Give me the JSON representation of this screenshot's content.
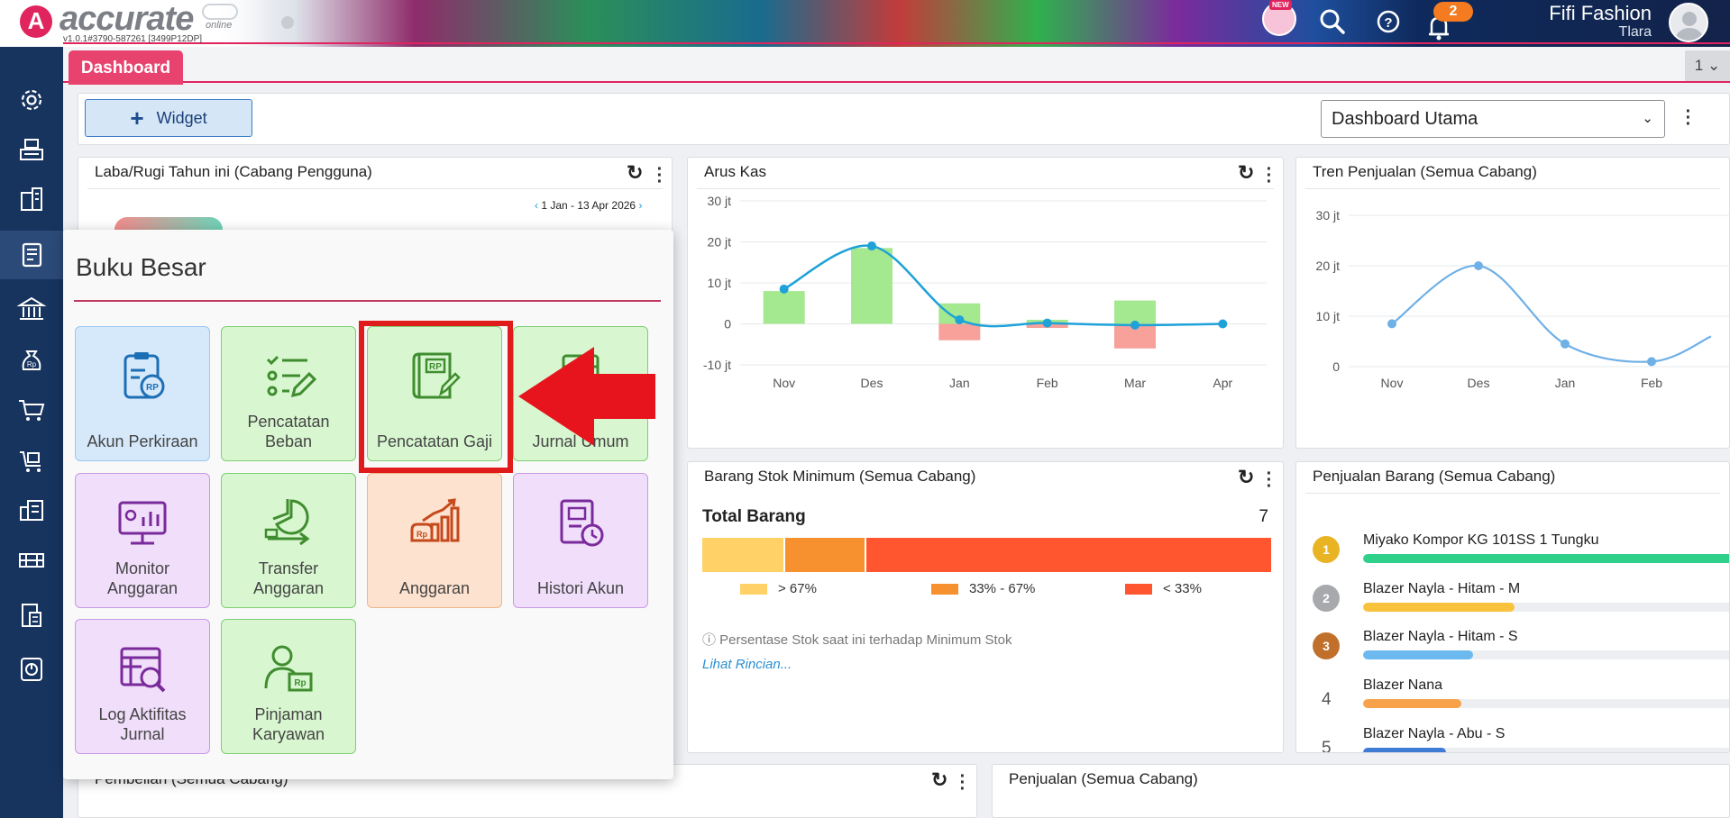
{
  "header": {
    "logo_letter": "A",
    "logo_text": "accurate",
    "logo_sub": "online",
    "version": "v1.0.1#3790-587261 [3499P12DP]",
    "new_badge": "NEW",
    "notification_count": "2",
    "user_name": "Fifi Fashion",
    "user_branch": "Tlara"
  },
  "tabs": {
    "active": "Dashboard",
    "count": "1"
  },
  "toolbar": {
    "widget_label": "Widget",
    "dashboard_select": "Dashboard Utama",
    "dropdown_chevron": "⌄"
  },
  "sidebar": {
    "items": [
      {
        "icon": "settings-icon"
      },
      {
        "icon": "cash-register-icon"
      },
      {
        "icon": "building-icon"
      },
      {
        "icon": "ledger-book-icon",
        "active": true
      },
      {
        "icon": "bank-icon"
      },
      {
        "icon": "money-bag-icon"
      },
      {
        "icon": "shopping-cart-icon"
      },
      {
        "icon": "cart-box-icon"
      },
      {
        "icon": "warehouse-icon"
      },
      {
        "icon": "factory-icon"
      },
      {
        "icon": "tax-document-icon"
      },
      {
        "icon": "report-chart-icon"
      }
    ]
  },
  "panels": {
    "laba_rugi": {
      "title": "Laba/Rugi Tahun ini (Cabang Pengguna)",
      "date_range": "1 Jan - 13 Apr 2026"
    },
    "arus_kas": {
      "title": "Arus Kas"
    },
    "tren_penjualan": {
      "title": "Tren Penjualan (Semua Cabang)"
    },
    "stok_minimum": {
      "title": "Barang Stok Minimum (Semua Cabang)",
      "total_label": "Total Barang",
      "total_value": "7",
      "legend": [
        {
          "label": "> 67%",
          "color": "#ffd166"
        },
        {
          "label": "33% - 67%",
          "color": "#f7912f"
        },
        {
          "label": "< 33%",
          "color": "#ff5630"
        }
      ],
      "note": "ⓘ Persentase Stok saat ini terhadap Minimum Stok",
      "link": "Lihat Rincian..."
    },
    "penjualan_barang": {
      "title": "Penjualan Barang (Semua Cabang)",
      "items": [
        {
          "rank": "1",
          "name": "Miyako Kompor KG 101SS 1 Tungku",
          "share": 1.0,
          "color": "#2fd18a",
          "badge": "#e9b424"
        },
        {
          "rank": "2",
          "name": "Blazer Nayla - Hitam - M",
          "share": 0.4,
          "color": "#f9c23c",
          "badge": "#a7a9ad"
        },
        {
          "rank": "3",
          "name": "Blazer Nayla - Hitam - S",
          "share": 0.29,
          "color": "#6cb9ef",
          "badge": "#c0702b"
        },
        {
          "rank": "4",
          "name": "Blazer Nana",
          "share": 0.26,
          "color": "#f7a24a",
          "badge": ""
        },
        {
          "rank": "5",
          "name": "Blazer Nayla - Abu - S",
          "share": 0.22,
          "color": "#3f7cd6",
          "badge": ""
        }
      ]
    },
    "pembelian": {
      "title": "Pembelian (Semua Cabang)"
    },
    "penjualan": {
      "title": "Penjualan (Semua Cabang)"
    }
  },
  "popup": {
    "title": "Buku Besar",
    "tiles": [
      {
        "label": "Akun Perkiraan",
        "icon": "account-clipboard-icon",
        "color": "blue"
      },
      {
        "label": "Pencatatan Beban",
        "icon": "expense-checklist-icon",
        "color": "green"
      },
      {
        "label": "Pencatatan Gaji",
        "icon": "payroll-book-icon",
        "color": "green"
      },
      {
        "label": "Jurnal Umum",
        "icon": "journal-icon",
        "color": "green"
      },
      {
        "label": "Monitor Anggaran",
        "icon": "budget-monitor-icon",
        "color": "purple"
      },
      {
        "label": "Transfer Anggaran",
        "icon": "budget-transfer-icon",
        "color": "green"
      },
      {
        "label": "Anggaran",
        "icon": "budget-chart-icon",
        "color": "orange"
      },
      {
        "label": "Histori Akun",
        "icon": "account-history-icon",
        "color": "purple"
      },
      {
        "label": "Log Aktifitas Jurnal",
        "icon": "journal-log-icon",
        "color": "purple"
      },
      {
        "label": "Pinjaman Karyawan",
        "icon": "employee-loan-icon",
        "color": "green"
      }
    ]
  },
  "chart_data": [
    {
      "type": "bar",
      "title": "Arus Kas",
      "categories": [
        "Nov",
        "Des",
        "Jan",
        "Feb",
        "Mar",
        "Apr"
      ],
      "series": [
        {
          "values": [
            8,
            18.5,
            5,
            1,
            5.7,
            0
          ]
        },
        {
          "values": [
            0,
            0,
            -4,
            -1,
            -6,
            0
          ]
        },
        {
          "values": [
            8.5,
            19,
            1,
            0.2,
            -0.3,
            0
          ]
        }
      ],
      "ylim": [
        -10,
        30
      ],
      "ticks": [
        "30 jt",
        "20 jt",
        "10 jt",
        "0",
        "-10 jt"
      ]
    },
    {
      "type": "line",
      "title": "Tren Penjualan (Semua Cabang)",
      "categories": [
        "Nov",
        "Des",
        "Jan",
        "Feb"
      ],
      "series": [
        {
          "values": [
            8.5,
            20,
            4.5,
            1
          ]
        }
      ],
      "ylim": [
        0,
        30
      ],
      "ticks": [
        "30 jt",
        "20 jt",
        "10 jt",
        "0"
      ]
    },
    {
      "type": "bar",
      "title": "Barang Stok Minimum (Semua Cabang)",
      "categories": [
        "> 67%",
        "33% - 67%",
        "< 33%"
      ],
      "values": [
        1,
        1,
        5
      ]
    }
  ]
}
